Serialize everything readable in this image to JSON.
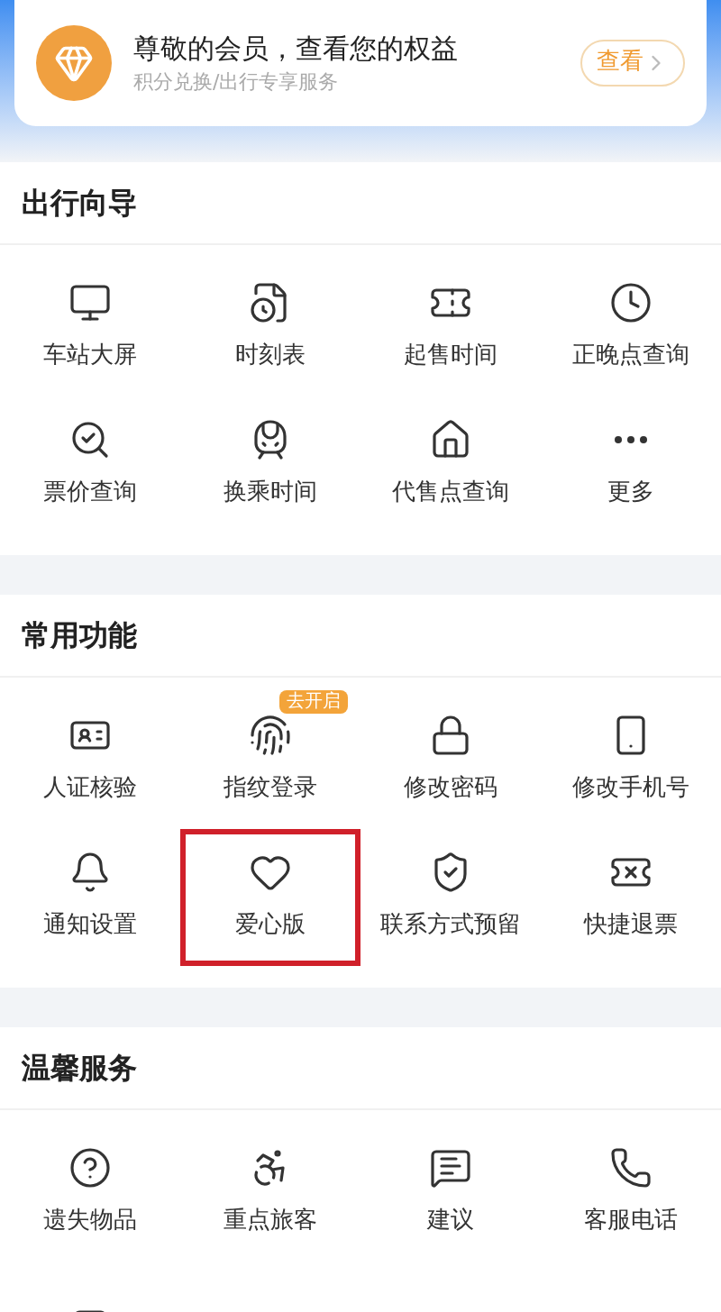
{
  "member_card": {
    "title": "尊敬的会员，查看您的权益",
    "subtitle": "积分兑换/出行专享服务",
    "button": "查看"
  },
  "sections": [
    {
      "title": "出行向导",
      "items": [
        {
          "label": "车站大屏",
          "highlighted": false
        },
        {
          "label": "时刻表",
          "highlighted": false
        },
        {
          "label": "起售时间",
          "highlighted": false
        },
        {
          "label": "正晚点查询",
          "highlighted": false
        },
        {
          "label": "票价查询",
          "highlighted": false
        },
        {
          "label": "换乘时间",
          "highlighted": false
        },
        {
          "label": "代售点查询",
          "highlighted": false
        },
        {
          "label": "更多",
          "highlighted": false
        }
      ]
    },
    {
      "title": "常用功能",
      "items": [
        {
          "label": "人证核验",
          "highlighted": false
        },
        {
          "label": "指纹登录",
          "highlighted": false,
          "badge": "去开启"
        },
        {
          "label": "修改密码",
          "highlighted": false
        },
        {
          "label": "修改手机号",
          "highlighted": false
        },
        {
          "label": "通知设置",
          "highlighted": false
        },
        {
          "label": "爱心版",
          "highlighted": true
        },
        {
          "label": "联系方式预留",
          "highlighted": false
        },
        {
          "label": "快捷退票",
          "highlighted": false
        }
      ]
    },
    {
      "title": "温馨服务",
      "items": [
        {
          "label": "遗失物品",
          "highlighted": false
        },
        {
          "label": "重点旅客",
          "highlighted": false
        },
        {
          "label": "建议",
          "highlighted": false
        },
        {
          "label": "客服电话",
          "highlighted": false
        },
        {
          "highlighted": false
        }
      ]
    }
  ]
}
